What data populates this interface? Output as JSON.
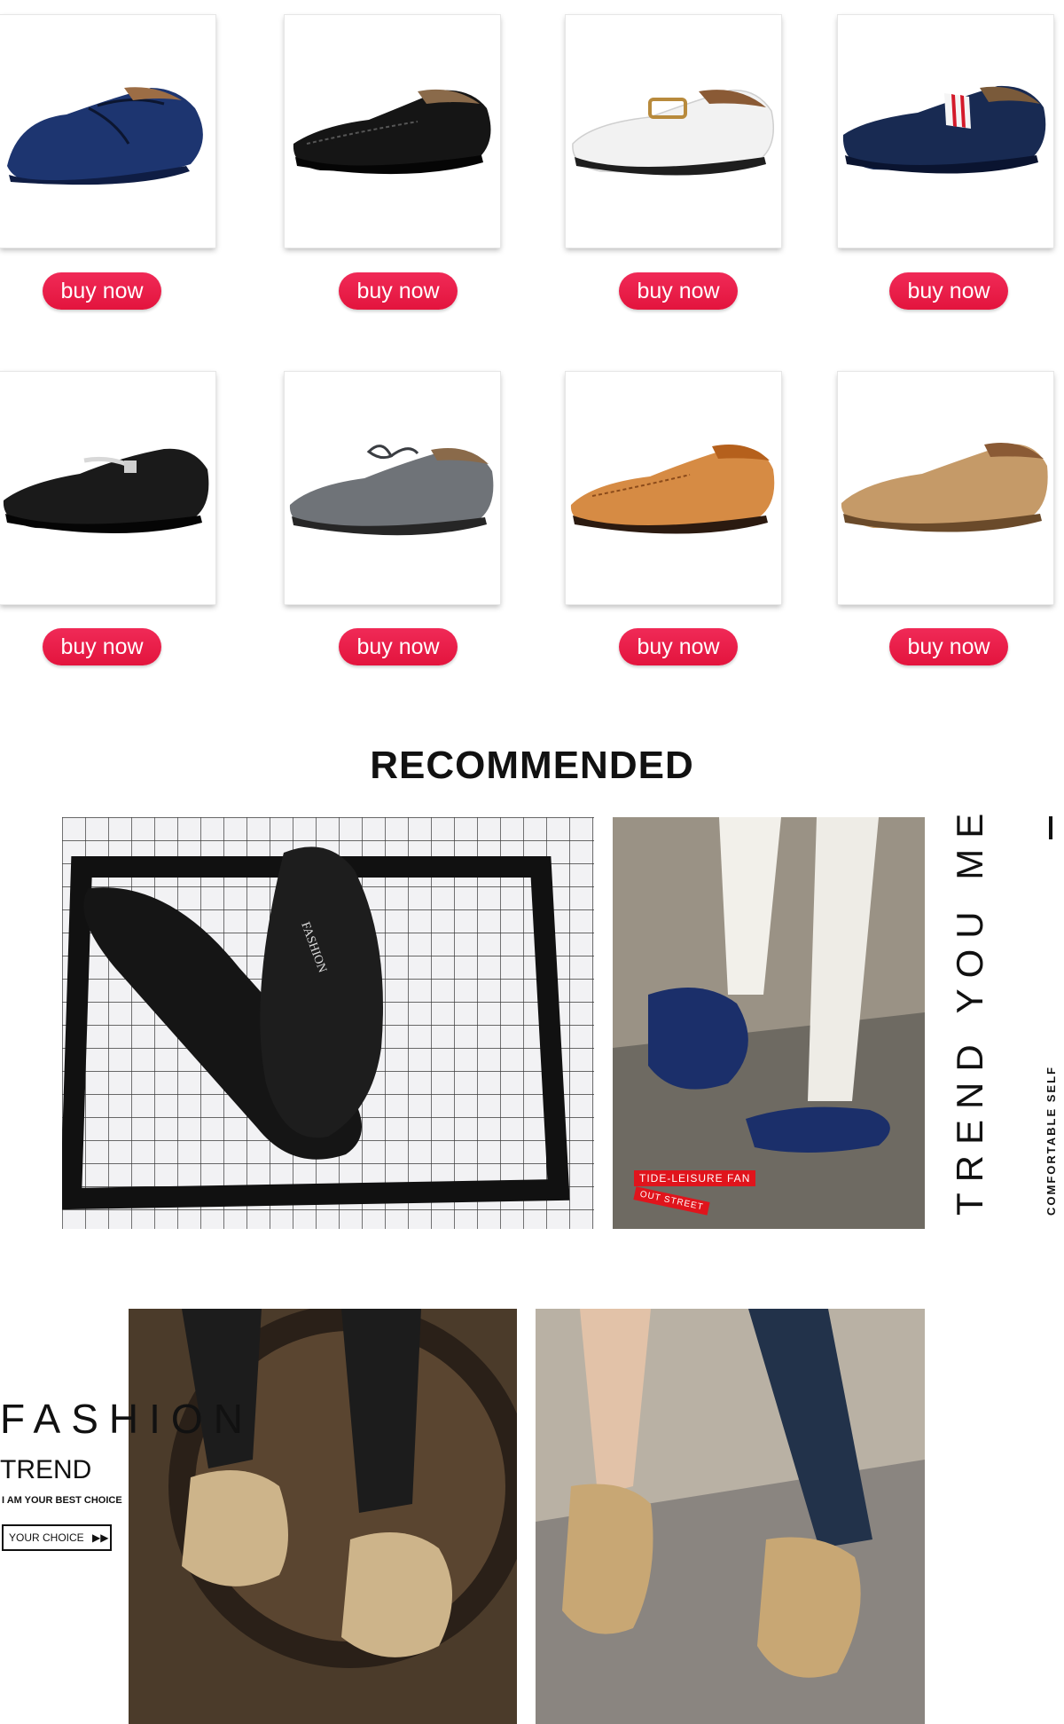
{
  "products": [
    {
      "name": "navy suede tie loafer",
      "button": "buy now",
      "color": "#1d3570"
    },
    {
      "name": "black leather loafer",
      "button": "buy now",
      "color": "#151515"
    },
    {
      "name": "white buckle loafer",
      "button": "buy now",
      "color": "#f4f4f4"
    },
    {
      "name": "navy stripe loafer",
      "button": "buy now",
      "color": "#182a52"
    },
    {
      "name": "black buckle loafer",
      "button": "buy now",
      "color": "#1a1a1a"
    },
    {
      "name": "grey suede tie loafer",
      "button": "buy now",
      "color": "#6f7378"
    },
    {
      "name": "tan leather loafer",
      "button": "buy now",
      "color": "#d68b44"
    },
    {
      "name": "camel suede loafer",
      "button": "buy now",
      "color": "#c59a68"
    }
  ],
  "recommended": {
    "title": "RECOMMENDED",
    "side_big": "TREND YOU ME",
    "side_small": "COMFORTABLE SELF",
    "fashion_print": "FASHION",
    "tag1": "TIDE-LEISURE FAN",
    "tag2": "OUT STREET"
  },
  "promo": {
    "word1": "FASHION",
    "word2": "TREND",
    "tagline": "I AM YOUR BEST CHOICE",
    "button": "YOUR CHOICE"
  },
  "colors": {
    "accent": "#e61e4b"
  }
}
